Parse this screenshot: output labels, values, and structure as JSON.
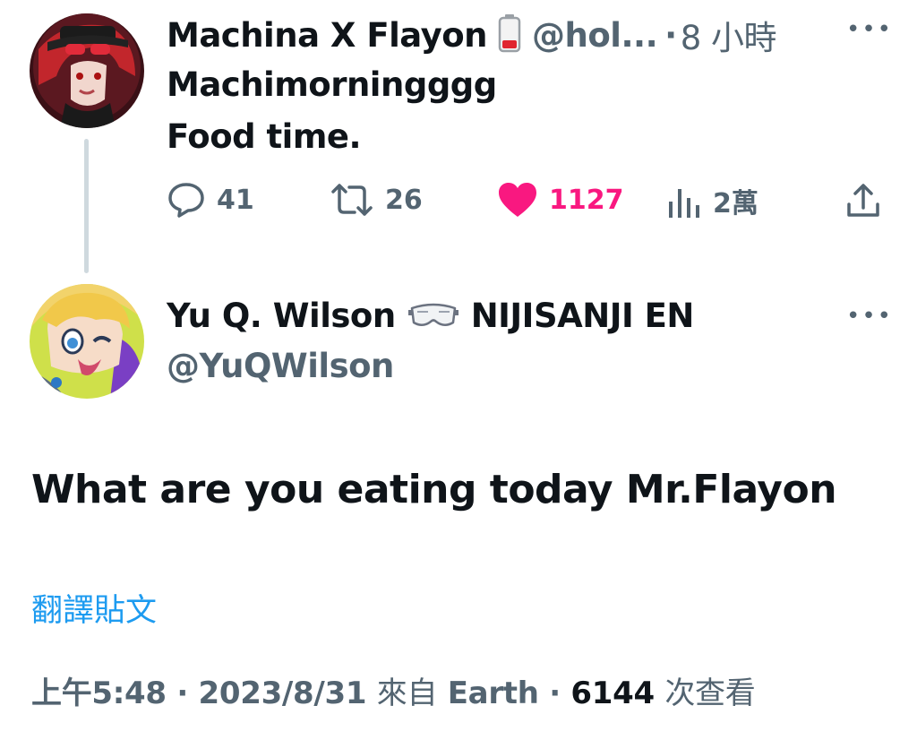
{
  "tweet1": {
    "display_name": "Machina X Flayon",
    "badge_icon": "battery-low-icon",
    "handle": "@hol...",
    "separator": "·",
    "time_ago": "8 小時",
    "more_icon": "more-horizontal-icon",
    "lines": [
      "Machimorningggg",
      "Food time."
    ],
    "actions": {
      "replies": "41",
      "retweets": "26",
      "likes": "1127",
      "views": "2萬"
    },
    "liked": true,
    "like_color": "#f91880"
  },
  "tweet2": {
    "display_name": "Yu Q. Wilson",
    "badge_icon": "goggles-icon",
    "affiliation": "NIJISANJI EN",
    "handle": "@YuQWilson",
    "more_icon": "more-horizontal-icon",
    "text": "What are you eating today Mr.Flayon",
    "translate_label": "翻譯貼文",
    "meta": {
      "time": "上午5:48",
      "dot1": "·",
      "date": "2023/8/31",
      "source_prefix": "來自",
      "source": "Earth",
      "dot2": "·",
      "views_count": "6144",
      "views_label": "次查看"
    }
  },
  "colors": {
    "text_primary": "#0f1419",
    "text_secondary": "#536471",
    "link": "#1d9bf0",
    "like": "#f91880",
    "thread_line": "#cfd9de"
  }
}
